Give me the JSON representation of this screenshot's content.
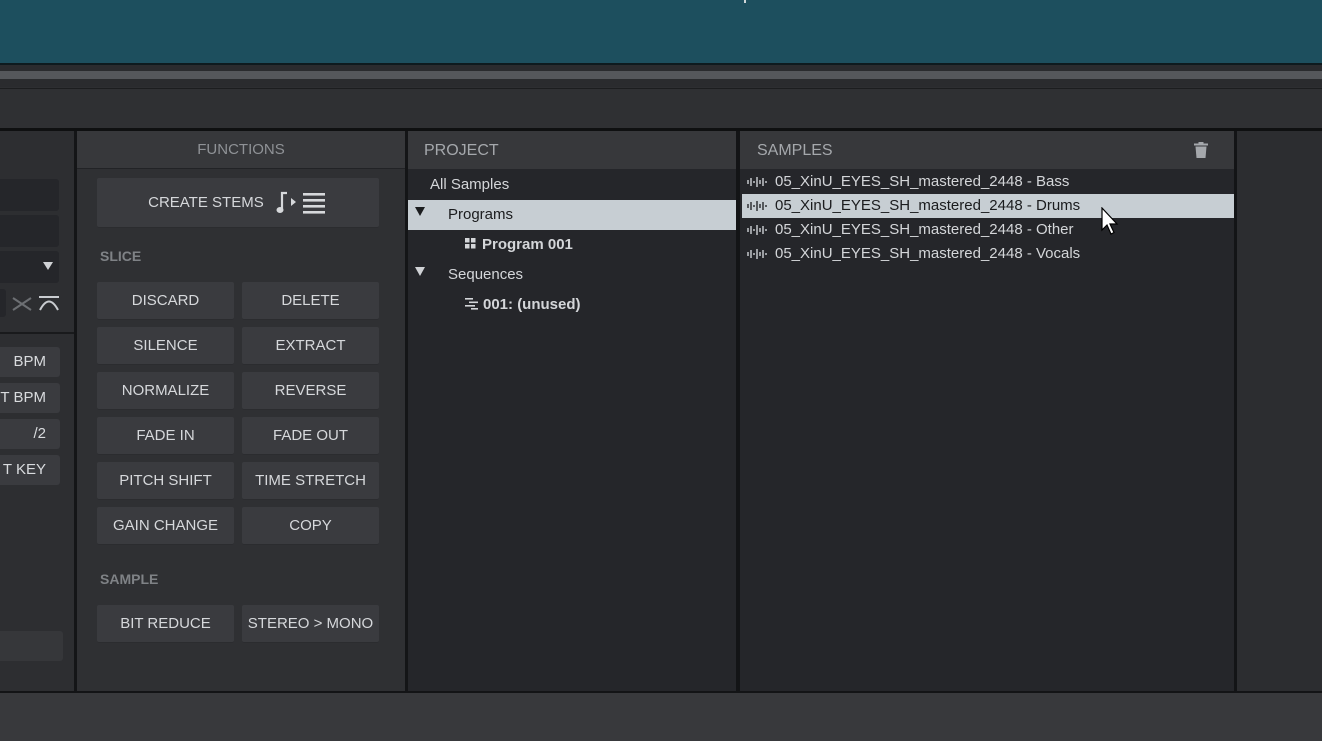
{
  "left_panel": {
    "buttons": [
      "BPM",
      "T BPM",
      "/2",
      "T KEY"
    ]
  },
  "functions": {
    "header": "FUNCTIONS",
    "create_stems": "CREATE STEMS",
    "slice_label": "SLICE",
    "slice_buttons": {
      "discard": "DISCARD",
      "delete": "DELETE",
      "silence": "SILENCE",
      "extract": "EXTRACT",
      "normalize": "NORMALIZE",
      "reverse": "REVERSE",
      "fade_in": "FADE IN",
      "fade_out": "FADE OUT",
      "pitch_shift": "PITCH SHIFT",
      "time_stretch": "TIME STRETCH",
      "gain_change": "GAIN CHANGE",
      "copy": "COPY"
    },
    "sample_label": "SAMPLE",
    "sample_buttons": {
      "bit_reduce": "BIT REDUCE",
      "stereo_mono": "STEREO > MONO"
    }
  },
  "project": {
    "header": "PROJECT",
    "tree": {
      "all_samples": "All Samples",
      "programs": "Programs",
      "program_001": "Program 001",
      "sequences": "Sequences",
      "sequence_001": "001: (unused)"
    }
  },
  "samples": {
    "header": "SAMPLES",
    "items": [
      "05_XinU_EYES_SH_mastered_2448 - Bass",
      "05_XinU_EYES_SH_mastered_2448 - Drums",
      "05_XinU_EYES_SH_mastered_2448 - Other",
      "05_XinU_EYES_SH_mastered_2448 - Vocals"
    ],
    "selected_index": 1
  },
  "colors": {
    "waveform_band": "#1d4f5e",
    "selection": "#c7ced3",
    "panel_bg": "#25262a",
    "button_bg": "#3a3b3f"
  },
  "icons": [
    "waveform-icon",
    "note-stems-icon",
    "grid-icon",
    "sequence-icon",
    "trash-icon",
    "dropdown-arrow-icon",
    "expand-triangle-icon",
    "cross-fade-icon",
    "curve-fade-icon",
    "mouse-pointer-icon"
  ]
}
